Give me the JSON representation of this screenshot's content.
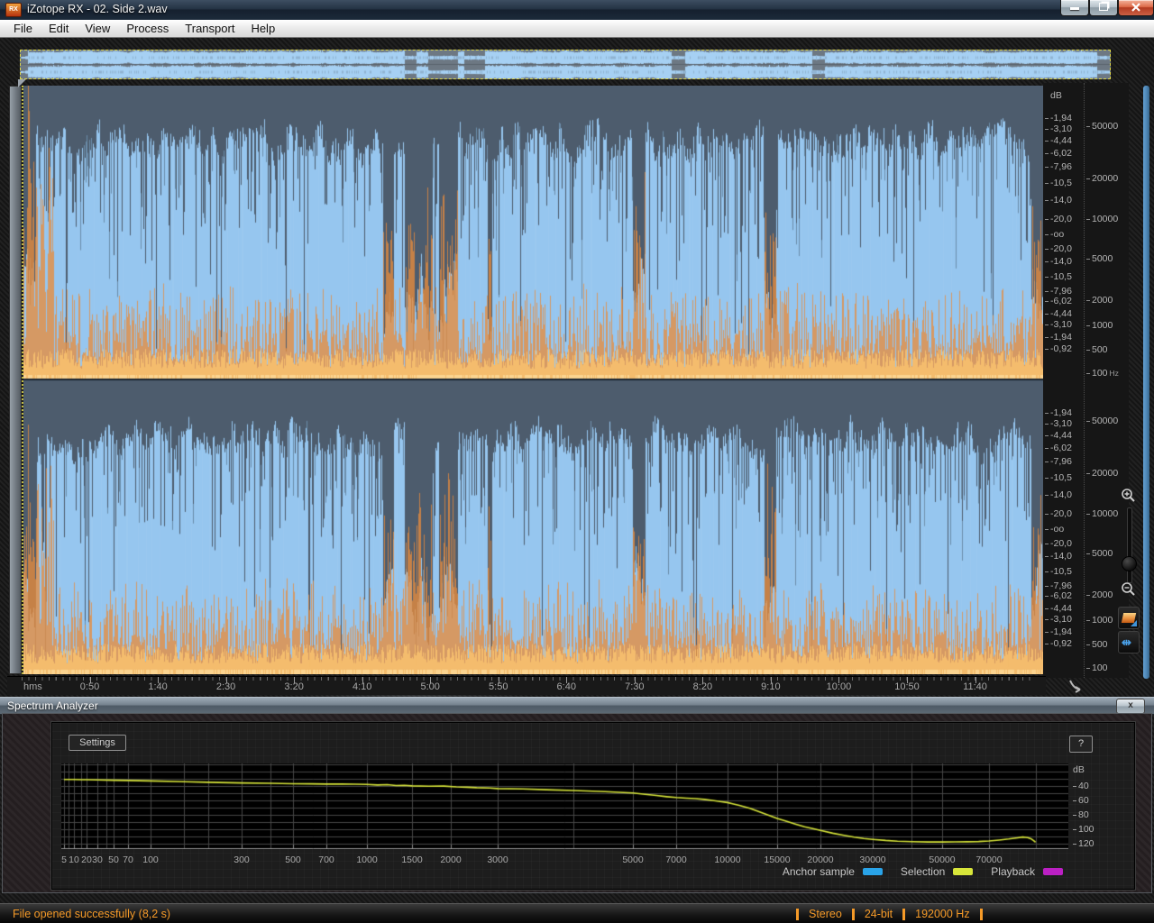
{
  "window": {
    "title": "iZotope RX - 02. Side 2.wav"
  },
  "menu": {
    "items": [
      "File",
      "Edit",
      "View",
      "Process",
      "Transport",
      "Help"
    ]
  },
  "editor": {
    "db_scale": {
      "header": "dB",
      "values": [
        "-1,94",
        "-3,10",
        "-4,44",
        "-6,02",
        "-7,96",
        "-10,5",
        "-14,0",
        "-20,0",
        "-oo",
        "-20,0",
        "-14,0",
        "-10,5",
        "-7,96",
        "-6,02",
        "-4,44",
        "-3,10",
        "-1,94",
        "-0,92"
      ]
    },
    "freq_scale": {
      "values": [
        "50000",
        "20000",
        "10000",
        "5000",
        "2000",
        "1000",
        "500",
        "100"
      ],
      "unit": "Hz"
    },
    "time_ruler": {
      "unit": "hms",
      "labels": [
        "0:50",
        "1:40",
        "2:30",
        "3:20",
        "4:10",
        "5:00",
        "5:50",
        "6:40",
        "7:30",
        "8:20",
        "9:10",
        "10:00",
        "10:50",
        "11:40"
      ]
    }
  },
  "spectrum_analyzer": {
    "title": "Spectrum Analyzer",
    "settings_button": "Settings",
    "help_button": "?",
    "close_button": "x",
    "legend": [
      {
        "label": "Anchor sample",
        "color": "#29a3e8"
      },
      {
        "label": "Selection",
        "color": "#d8e63a"
      },
      {
        "label": "Playback",
        "color": "#bc20c4"
      }
    ],
    "chart_data": {
      "type": "line",
      "x_scale": "log",
      "y_label": "dB",
      "x_ticks": [
        "5",
        "10",
        "20",
        "30",
        "50",
        "70",
        "100",
        "300",
        "500",
        "700",
        "1000",
        "1500",
        "2000",
        "3000",
        "5000",
        "7000",
        "10000",
        "15000",
        "20000",
        "30000",
        "50000",
        "70000"
      ],
      "y_ticks": [
        "40",
        "60",
        "80",
        "100",
        "120"
      ],
      "series": [
        {
          "name": "Selection",
          "color": "#d8e63a",
          "points": [
            [
              5,
              -31
            ],
            [
              8,
              -31
            ],
            [
              10,
              -31
            ],
            [
              15,
              -31.2
            ],
            [
              20,
              -31.2
            ],
            [
              30,
              -31.5
            ],
            [
              50,
              -32
            ],
            [
              70,
              -32.3
            ],
            [
              100,
              -33
            ],
            [
              150,
              -34
            ],
            [
              200,
              -34.8
            ],
            [
              300,
              -35.8
            ],
            [
              400,
              -36.3
            ],
            [
              500,
              -36.8
            ],
            [
              600,
              -37
            ],
            [
              700,
              -37.3
            ],
            [
              800,
              -37.1
            ],
            [
              900,
              -37.5
            ],
            [
              1000,
              -37.9
            ],
            [
              1100,
              -38.6
            ],
            [
              1200,
              -38.2
            ],
            [
              1300,
              -39.3
            ],
            [
              1400,
              -39
            ],
            [
              1500,
              -39.9
            ],
            [
              1700,
              -40.4
            ],
            [
              1900,
              -40.1
            ],
            [
              2100,
              -41.3
            ],
            [
              2300,
              -41.7
            ],
            [
              2500,
              -42.4
            ],
            [
              2800,
              -42.9
            ],
            [
              3000,
              -43.6
            ],
            [
              3300,
              -44.1
            ],
            [
              3600,
              -45.1
            ],
            [
              4000,
              -46.3
            ],
            [
              4500,
              -47.9
            ],
            [
              5000,
              -49.6
            ],
            [
              5500,
              -51.5
            ],
            [
              6000,
              -53.2
            ],
            [
              6500,
              -54.8
            ],
            [
              7000,
              -56
            ],
            [
              7500,
              -56.9
            ],
            [
              8000,
              -57.5
            ],
            [
              8500,
              -58.6
            ],
            [
              9000,
              -60
            ],
            [
              9500,
              -61.5
            ],
            [
              10000,
              -63
            ],
            [
              10500,
              -64.9
            ],
            [
              11000,
              -67
            ],
            [
              12000,
              -71
            ],
            [
              13000,
              -76
            ],
            [
              14000,
              -80.5
            ],
            [
              15000,
              -85
            ],
            [
              16000,
              -89
            ],
            [
              17000,
              -93
            ],
            [
              18000,
              -96.5
            ],
            [
              19000,
              -99
            ],
            [
              20000,
              -101.5
            ],
            [
              22000,
              -105.5
            ],
            [
              24000,
              -108.5
            ],
            [
              26000,
              -111
            ],
            [
              28000,
              -112.8
            ],
            [
              30000,
              -114
            ],
            [
              33000,
              -115.5
            ],
            [
              36000,
              -116.5
            ],
            [
              40000,
              -117.2
            ],
            [
              45000,
              -117.6
            ],
            [
              50000,
              -117.6
            ],
            [
              55000,
              -117.5
            ],
            [
              60000,
              -117.4
            ],
            [
              65000,
              -117
            ],
            [
              70000,
              -116.3
            ],
            [
              75000,
              -115
            ],
            [
              80000,
              -113.5
            ],
            [
              85000,
              -111.8
            ],
            [
              88000,
              -110.8
            ],
            [
              91000,
              -111.5
            ],
            [
              93000,
              -113
            ],
            [
              95000,
              -116
            ],
            [
              96000,
              -118
            ]
          ]
        }
      ]
    }
  },
  "status_bar": {
    "message": "File opened successfully (8,2 s)",
    "fields": [
      "Stereo",
      "24-bit",
      "192000 Hz"
    ]
  },
  "colors": {
    "wave_blue": "#96c6ef",
    "spectrogram_orange": "#e8913f",
    "selection_yellow": "#ddd64a",
    "scrollbar_blue": "#4d86b5",
    "status_orange": "#f59a28",
    "curve_yellow": "#d8e63a"
  }
}
